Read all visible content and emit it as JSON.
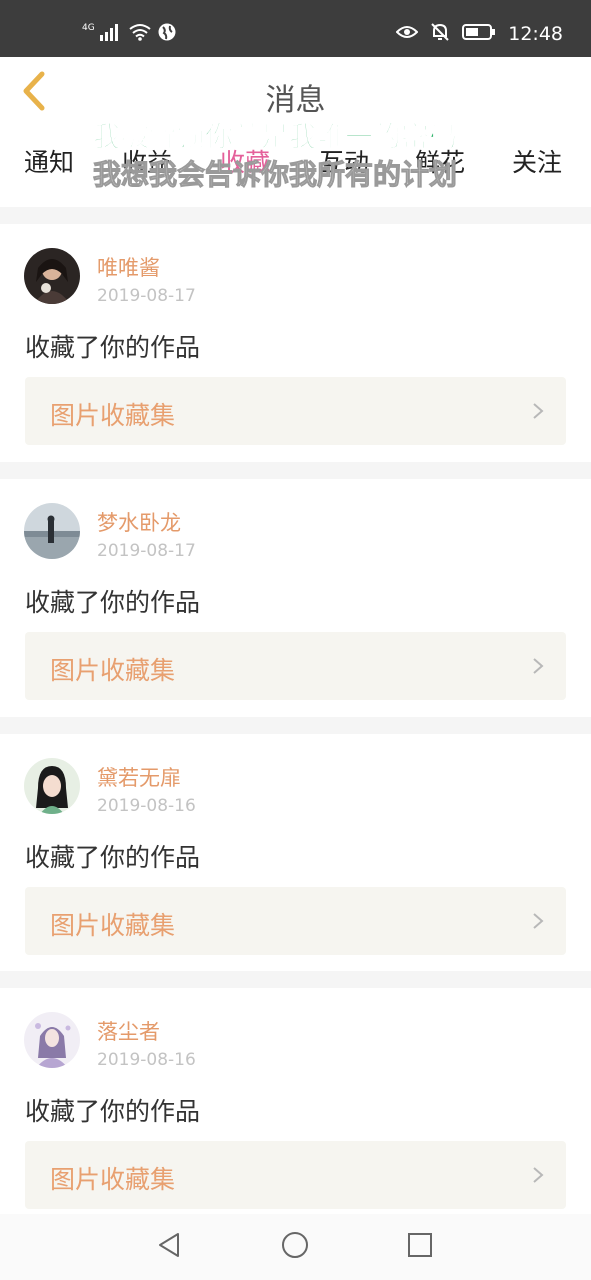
{
  "status_bar": {
    "network": "4G",
    "time": "12:48",
    "icons": [
      "signal-icon",
      "wifi-icon",
      "vpn-globe-icon",
      "eye-icon",
      "bell-off-icon",
      "battery-icon"
    ]
  },
  "header": {
    "title": "消息",
    "back_icon": "back-chevron-icon"
  },
  "tabs": [
    {
      "label": "通知",
      "active": false
    },
    {
      "label": "收益",
      "active": false
    },
    {
      "label": "收藏",
      "active": true
    },
    {
      "label": "互动",
      "active": false
    },
    {
      "label": "鲜花",
      "active": false
    },
    {
      "label": "关注",
      "active": false
    }
  ],
  "overlay": {
    "line1": "我被解锁你就是我唯一的密码",
    "line2": "我想我会告诉你我所有的计划"
  },
  "messages": [
    {
      "name": "唯唯酱",
      "date": "2019-08-17",
      "action": "收藏了你的作品",
      "collection": "图片收藏集"
    },
    {
      "name": "梦水卧龙",
      "date": "2019-08-17",
      "action": "收藏了你的作品",
      "collection": "图片收藏集"
    },
    {
      "name": "黛若无扉",
      "date": "2019-08-16",
      "action": "收藏了你的作品",
      "collection": "图片收藏集"
    },
    {
      "name": "落尘者",
      "date": "2019-08-16",
      "action": "收藏了你的作品",
      "collection": "图片收藏集"
    }
  ],
  "colors": {
    "status_bar": "#3d3d3d",
    "active_tab": "#e4609a",
    "username": "#e49a6a",
    "collection_label": "#e8a070",
    "back_icon": "#e8b24a"
  },
  "nav_bar": {
    "icons": [
      "nav-back-icon",
      "nav-home-icon",
      "nav-recent-icon"
    ]
  }
}
